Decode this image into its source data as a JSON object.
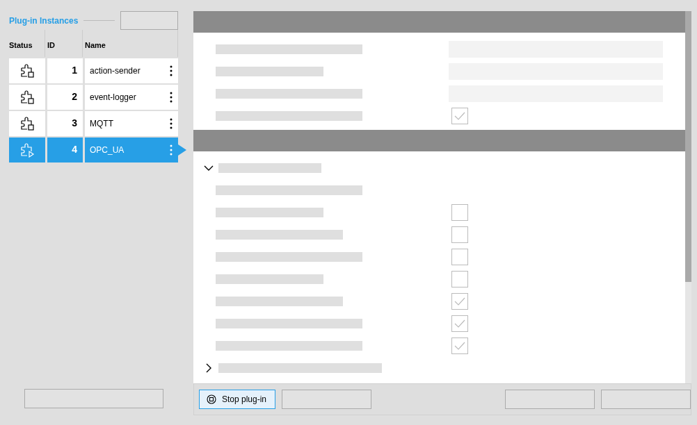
{
  "sidebar": {
    "title": "Plug-in Instances",
    "header_button": {
      "kind": "blank"
    },
    "columns": [
      "Status",
      "ID",
      "Name"
    ],
    "rows": [
      {
        "kind": "stopped",
        "id": "1",
        "name": "action-sender",
        "selected": false
      },
      {
        "kind": "stopped",
        "id": "2",
        "name": "event-logger",
        "selected": false
      },
      {
        "kind": "stopped",
        "id": "3",
        "name": "MQTT",
        "selected": false
      },
      {
        "kind": "running",
        "id": "4",
        "name": "OPC_UA",
        "selected": true
      }
    ],
    "footer_button": {
      "kind": "blank"
    }
  },
  "panel": {
    "sections": [
      {
        "items": [
          {
            "kind": "field"
          },
          {
            "kind": "field"
          },
          {
            "kind": "field"
          },
          {
            "kind": "checkbox",
            "checked": true
          }
        ]
      },
      {
        "groups": [
          {
            "expanded": true,
            "items": [
              {
                "kind": "label"
              },
              {
                "kind": "checkbox",
                "checked": false
              },
              {
                "kind": "checkbox",
                "checked": false
              },
              {
                "kind": "checkbox",
                "checked": false
              },
              {
                "kind": "checkbox",
                "checked": false
              },
              {
                "kind": "checkbox",
                "checked": true
              },
              {
                "kind": "checkbox",
                "checked": true
              },
              {
                "kind": "checkbox",
                "checked": true
              }
            ]
          },
          {
            "expanded": false
          }
        ]
      }
    ]
  },
  "footer": {
    "buttons": [
      {
        "kind": "stop",
        "label": "Stop plug-in",
        "focused": true
      },
      {
        "kind": "blank"
      },
      {
        "kind": "spacer"
      },
      {
        "kind": "blank"
      },
      {
        "kind": "blank"
      }
    ]
  }
}
